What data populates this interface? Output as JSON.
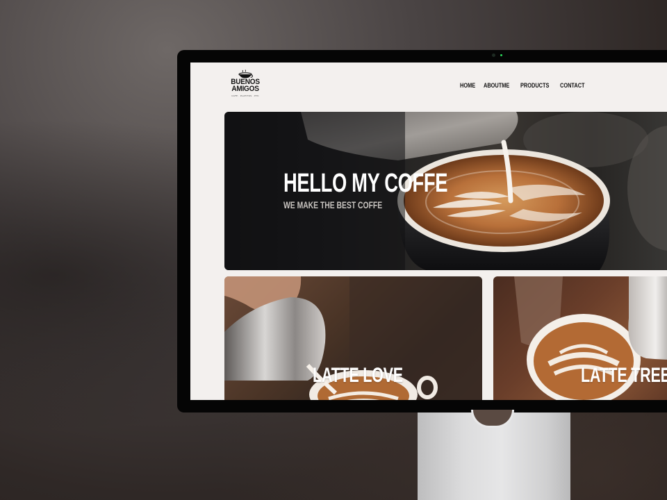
{
  "site": {
    "logo": {
      "line1": "BUENOS",
      "line2": "AMIGOS",
      "tagline": "CAFE · PLATITOS · ETC",
      "icon": "coffee-cup-icon"
    },
    "nav": [
      {
        "label": "HOME"
      },
      {
        "label": "ABOUTME"
      },
      {
        "label": "PRODUCTS"
      },
      {
        "label": "CONTACT"
      }
    ]
  },
  "hero": {
    "title": "HELLO MY COFFE",
    "subtitle": "WE MAKE THE BEST COFFE"
  },
  "cards": [
    {
      "title": "LATTE LOVE"
    },
    {
      "title": "LATTE TREE"
    }
  ],
  "colors": {
    "screen_background": "#f3f0ee",
    "text_dark": "#111111",
    "coffee_crema": "#b8703a",
    "milk": "#f4ece2"
  }
}
